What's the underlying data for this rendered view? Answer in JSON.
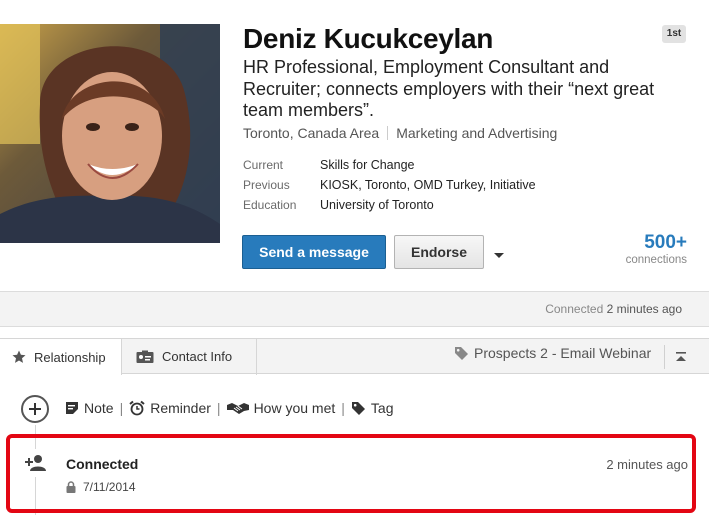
{
  "profile": {
    "name": "Deniz Kucukceylan",
    "degree": "1st",
    "headline": "HR Professional, Employment Consultant and Recruiter; connects employers with their “next great team members”.",
    "location": "Toronto, Canada Area",
    "industry": "Marketing and Advertising",
    "facts": [
      {
        "label": "Current",
        "value": "Skills for Change"
      },
      {
        "label": "Previous",
        "value": "KIOSK, Toronto, OMD Turkey, Initiative"
      },
      {
        "label": "Education",
        "value": "University of Toronto"
      }
    ],
    "send_message_label": "Send a message",
    "endorse_label": "Endorse",
    "connections_count": "500+",
    "connections_label": "connections",
    "accent_color": "#287bbc"
  },
  "connected_bar": {
    "prefix": "Connected",
    "time": "2 minutes ago"
  },
  "relationship": {
    "tabs": [
      {
        "label": "Relationship",
        "icon": "star-icon"
      },
      {
        "label": "Contact Info",
        "icon": "contact-card-icon"
      }
    ],
    "tag": "Prospects 2 - Email Webinar",
    "actions": [
      {
        "label": "Note",
        "icon": "note-icon"
      },
      {
        "label": "Reminder",
        "icon": "alarm-clock-icon"
      },
      {
        "label": "How you met",
        "icon": "handshake-icon"
      },
      {
        "label": "Tag",
        "icon": "tag-icon"
      }
    ]
  },
  "timeline_entry": {
    "title": "Connected",
    "date": "7/11/2014",
    "time": "2 minutes ago",
    "highlight_color": "#e30613"
  }
}
